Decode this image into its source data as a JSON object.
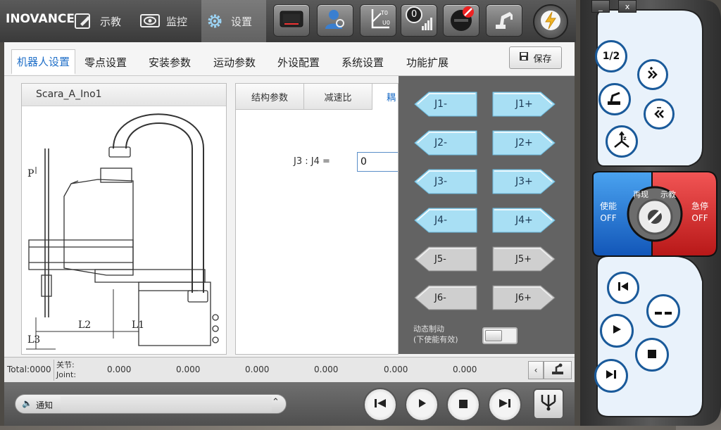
{
  "app": {
    "logo": "INOVANCE"
  },
  "nav": [
    {
      "label": "示教",
      "icon": "teach-edit-icon"
    },
    {
      "label": "监控",
      "icon": "monitor-eye-icon"
    },
    {
      "label": "设置",
      "icon": "gear-icon",
      "active": true
    }
  ],
  "toolbar_icons": [
    "screen-icon",
    "user-search-icon",
    "coordinate-axis-icon",
    "speed-level-icon",
    "stop-sign-icon",
    "robot-arm-icon",
    "power-lightning-icon"
  ],
  "toolbar": {
    "speed_value": "0"
  },
  "subtabs": [
    {
      "label": "机器人设置",
      "active": true
    },
    {
      "label": "零点设置"
    },
    {
      "label": "安装参数"
    },
    {
      "label": "运动参数"
    },
    {
      "label": "外设配置"
    },
    {
      "label": "系统设置"
    },
    {
      "label": "功能扩展"
    }
  ],
  "save": {
    "label": "保存"
  },
  "robot": {
    "model": "Scara_A_Ino1",
    "diagram_labels": {
      "p": "P",
      "l1": "L1",
      "l2": "L2",
      "l3": "L3"
    }
  },
  "params": {
    "tabs": [
      {
        "label": "结构参数"
      },
      {
        "label": "减速比"
      },
      {
        "label": "耦",
        "active": true
      }
    ],
    "ratio_label": "J3 : J4 =",
    "ratio_value": "0"
  },
  "jog": {
    "buttons": [
      {
        "minus": "J1-",
        "plus": "J1+",
        "enabled": true
      },
      {
        "minus": "J2-",
        "plus": "J2+",
        "enabled": true
      },
      {
        "minus": "J3-",
        "plus": "J3+",
        "enabled": true
      },
      {
        "minus": "J4-",
        "plus": "J4+",
        "enabled": true
      },
      {
        "minus": "J5-",
        "plus": "J5+",
        "enabled": false
      },
      {
        "minus": "J6-",
        "plus": "J6+",
        "enabled": false
      }
    ],
    "dynamic_brake": {
      "line1": "动态制动",
      "line2": "(下使能有效)"
    }
  },
  "status": {
    "total": "Total:0000",
    "joint_cn": "关节:",
    "joint_en": "Joint:",
    "values": [
      "0.000",
      "0.000",
      "0.000",
      "0.000",
      "0.000",
      "0.000"
    ]
  },
  "notify": {
    "label": "通知",
    "text": ""
  },
  "pendant": {
    "window": {
      "minimize": "_",
      "close": "x"
    },
    "half_speed": "1/2",
    "enable": {
      "label": "使能",
      "state": "OFF"
    },
    "replay": "再现",
    "teach": "示教",
    "estop": {
      "label": "急停",
      "state": "OFF"
    }
  },
  "colors": {
    "accent_blue": "#1f6fc8",
    "jog_blue": "#a8dff4",
    "enable_blue": "#1e6fd0",
    "estop_red": "#e03030"
  }
}
